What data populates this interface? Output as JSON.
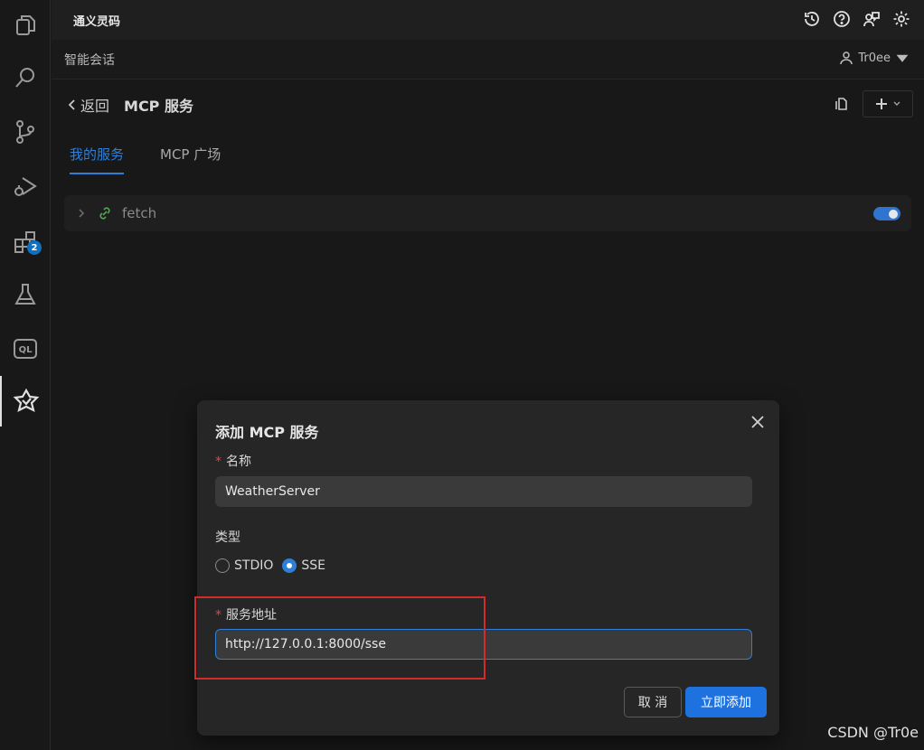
{
  "app": {
    "title": "通义灵码"
  },
  "activity_bar": {
    "extensions_badge": "2"
  },
  "header": {
    "chat_title": "智能会话",
    "user_name": "Tr0ee"
  },
  "nav": {
    "back_label": "返回",
    "page_title": "MCP 服务",
    "tabs": [
      {
        "label": "我的服务",
        "active": true
      },
      {
        "label": "MCP 广场",
        "active": false
      }
    ]
  },
  "servers": [
    {
      "name": "fetch",
      "enabled": true
    }
  ],
  "dialog": {
    "title": "添加 MCP 服务",
    "name_label": "名称",
    "name_value": "WeatherServer",
    "type_label": "类型",
    "type_options": [
      "STDIO",
      "SSE"
    ],
    "type_selected": "SSE",
    "url_label": "服务地址",
    "url_value": "http://127.0.0.1:8000/sse",
    "required_mark": "*",
    "cancel_label": "取 消",
    "submit_label": "立即添加"
  },
  "colors": {
    "accent": "#2f7fd8",
    "primary_button": "#1e72e0",
    "highlight": "#d12b2b"
  },
  "watermark": "CSDN @Tr0e"
}
